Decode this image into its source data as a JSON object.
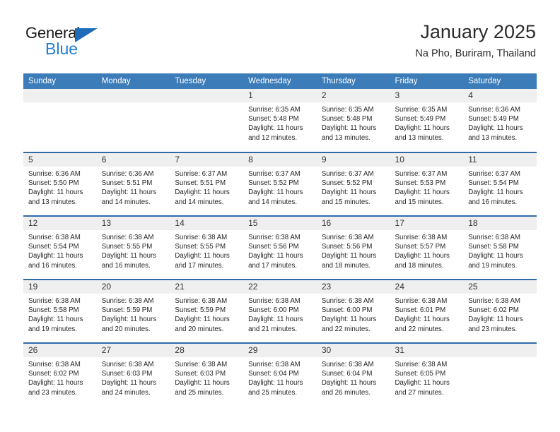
{
  "brand": {
    "name_part1": "General",
    "name_part2": "Blue",
    "accent_color": "#1e7fd4",
    "triangle_color": "#1e6bb8"
  },
  "header": {
    "title": "January 2025",
    "location": "Na Pho, Buriram, Thailand"
  },
  "calendar": {
    "header_bg": "#3b7cb9",
    "daynum_bg": "#efefef",
    "row_divider_color": "#2f6aa8",
    "weekday_headers": [
      "Sunday",
      "Monday",
      "Tuesday",
      "Wednesday",
      "Thursday",
      "Friday",
      "Saturday"
    ],
    "weeks": [
      [
        {
          "day": "",
          "sunrise": "",
          "sunset": "",
          "daylight_line1": "",
          "daylight_line2": ""
        },
        {
          "day": "",
          "sunrise": "",
          "sunset": "",
          "daylight_line1": "",
          "daylight_line2": ""
        },
        {
          "day": "",
          "sunrise": "",
          "sunset": "",
          "daylight_line1": "",
          "daylight_line2": ""
        },
        {
          "day": "1",
          "sunrise": "Sunrise: 6:35 AM",
          "sunset": "Sunset: 5:48 PM",
          "daylight_line1": "Daylight: 11 hours",
          "daylight_line2": "and 12 minutes."
        },
        {
          "day": "2",
          "sunrise": "Sunrise: 6:35 AM",
          "sunset": "Sunset: 5:48 PM",
          "daylight_line1": "Daylight: 11 hours",
          "daylight_line2": "and 13 minutes."
        },
        {
          "day": "3",
          "sunrise": "Sunrise: 6:35 AM",
          "sunset": "Sunset: 5:49 PM",
          "daylight_line1": "Daylight: 11 hours",
          "daylight_line2": "and 13 minutes."
        },
        {
          "day": "4",
          "sunrise": "Sunrise: 6:36 AM",
          "sunset": "Sunset: 5:49 PM",
          "daylight_line1": "Daylight: 11 hours",
          "daylight_line2": "and 13 minutes."
        }
      ],
      [
        {
          "day": "5",
          "sunrise": "Sunrise: 6:36 AM",
          "sunset": "Sunset: 5:50 PM",
          "daylight_line1": "Daylight: 11 hours",
          "daylight_line2": "and 13 minutes."
        },
        {
          "day": "6",
          "sunrise": "Sunrise: 6:36 AM",
          "sunset": "Sunset: 5:51 PM",
          "daylight_line1": "Daylight: 11 hours",
          "daylight_line2": "and 14 minutes."
        },
        {
          "day": "7",
          "sunrise": "Sunrise: 6:37 AM",
          "sunset": "Sunset: 5:51 PM",
          "daylight_line1": "Daylight: 11 hours",
          "daylight_line2": "and 14 minutes."
        },
        {
          "day": "8",
          "sunrise": "Sunrise: 6:37 AM",
          "sunset": "Sunset: 5:52 PM",
          "daylight_line1": "Daylight: 11 hours",
          "daylight_line2": "and 14 minutes."
        },
        {
          "day": "9",
          "sunrise": "Sunrise: 6:37 AM",
          "sunset": "Sunset: 5:52 PM",
          "daylight_line1": "Daylight: 11 hours",
          "daylight_line2": "and 15 minutes."
        },
        {
          "day": "10",
          "sunrise": "Sunrise: 6:37 AM",
          "sunset": "Sunset: 5:53 PM",
          "daylight_line1": "Daylight: 11 hours",
          "daylight_line2": "and 15 minutes."
        },
        {
          "day": "11",
          "sunrise": "Sunrise: 6:37 AM",
          "sunset": "Sunset: 5:54 PM",
          "daylight_line1": "Daylight: 11 hours",
          "daylight_line2": "and 16 minutes."
        }
      ],
      [
        {
          "day": "12",
          "sunrise": "Sunrise: 6:38 AM",
          "sunset": "Sunset: 5:54 PM",
          "daylight_line1": "Daylight: 11 hours",
          "daylight_line2": "and 16 minutes."
        },
        {
          "day": "13",
          "sunrise": "Sunrise: 6:38 AM",
          "sunset": "Sunset: 5:55 PM",
          "daylight_line1": "Daylight: 11 hours",
          "daylight_line2": "and 16 minutes."
        },
        {
          "day": "14",
          "sunrise": "Sunrise: 6:38 AM",
          "sunset": "Sunset: 5:55 PM",
          "daylight_line1": "Daylight: 11 hours",
          "daylight_line2": "and 17 minutes."
        },
        {
          "day": "15",
          "sunrise": "Sunrise: 6:38 AM",
          "sunset": "Sunset: 5:56 PM",
          "daylight_line1": "Daylight: 11 hours",
          "daylight_line2": "and 17 minutes."
        },
        {
          "day": "16",
          "sunrise": "Sunrise: 6:38 AM",
          "sunset": "Sunset: 5:56 PM",
          "daylight_line1": "Daylight: 11 hours",
          "daylight_line2": "and 18 minutes."
        },
        {
          "day": "17",
          "sunrise": "Sunrise: 6:38 AM",
          "sunset": "Sunset: 5:57 PM",
          "daylight_line1": "Daylight: 11 hours",
          "daylight_line2": "and 18 minutes."
        },
        {
          "day": "18",
          "sunrise": "Sunrise: 6:38 AM",
          "sunset": "Sunset: 5:58 PM",
          "daylight_line1": "Daylight: 11 hours",
          "daylight_line2": "and 19 minutes."
        }
      ],
      [
        {
          "day": "19",
          "sunrise": "Sunrise: 6:38 AM",
          "sunset": "Sunset: 5:58 PM",
          "daylight_line1": "Daylight: 11 hours",
          "daylight_line2": "and 19 minutes."
        },
        {
          "day": "20",
          "sunrise": "Sunrise: 6:38 AM",
          "sunset": "Sunset: 5:59 PM",
          "daylight_line1": "Daylight: 11 hours",
          "daylight_line2": "and 20 minutes."
        },
        {
          "day": "21",
          "sunrise": "Sunrise: 6:38 AM",
          "sunset": "Sunset: 5:59 PM",
          "daylight_line1": "Daylight: 11 hours",
          "daylight_line2": "and 20 minutes."
        },
        {
          "day": "22",
          "sunrise": "Sunrise: 6:38 AM",
          "sunset": "Sunset: 6:00 PM",
          "daylight_line1": "Daylight: 11 hours",
          "daylight_line2": "and 21 minutes."
        },
        {
          "day": "23",
          "sunrise": "Sunrise: 6:38 AM",
          "sunset": "Sunset: 6:00 PM",
          "daylight_line1": "Daylight: 11 hours",
          "daylight_line2": "and 22 minutes."
        },
        {
          "day": "24",
          "sunrise": "Sunrise: 6:38 AM",
          "sunset": "Sunset: 6:01 PM",
          "daylight_line1": "Daylight: 11 hours",
          "daylight_line2": "and 22 minutes."
        },
        {
          "day": "25",
          "sunrise": "Sunrise: 6:38 AM",
          "sunset": "Sunset: 6:02 PM",
          "daylight_line1": "Daylight: 11 hours",
          "daylight_line2": "and 23 minutes."
        }
      ],
      [
        {
          "day": "26",
          "sunrise": "Sunrise: 6:38 AM",
          "sunset": "Sunset: 6:02 PM",
          "daylight_line1": "Daylight: 11 hours",
          "daylight_line2": "and 23 minutes."
        },
        {
          "day": "27",
          "sunrise": "Sunrise: 6:38 AM",
          "sunset": "Sunset: 6:03 PM",
          "daylight_line1": "Daylight: 11 hours",
          "daylight_line2": "and 24 minutes."
        },
        {
          "day": "28",
          "sunrise": "Sunrise: 6:38 AM",
          "sunset": "Sunset: 6:03 PM",
          "daylight_line1": "Daylight: 11 hours",
          "daylight_line2": "and 25 minutes."
        },
        {
          "day": "29",
          "sunrise": "Sunrise: 6:38 AM",
          "sunset": "Sunset: 6:04 PM",
          "daylight_line1": "Daylight: 11 hours",
          "daylight_line2": "and 25 minutes."
        },
        {
          "day": "30",
          "sunrise": "Sunrise: 6:38 AM",
          "sunset": "Sunset: 6:04 PM",
          "daylight_line1": "Daylight: 11 hours",
          "daylight_line2": "and 26 minutes."
        },
        {
          "day": "31",
          "sunrise": "Sunrise: 6:38 AM",
          "sunset": "Sunset: 6:05 PM",
          "daylight_line1": "Daylight: 11 hours",
          "daylight_line2": "and 27 minutes."
        },
        {
          "day": "",
          "sunrise": "",
          "sunset": "",
          "daylight_line1": "",
          "daylight_line2": ""
        }
      ]
    ]
  }
}
